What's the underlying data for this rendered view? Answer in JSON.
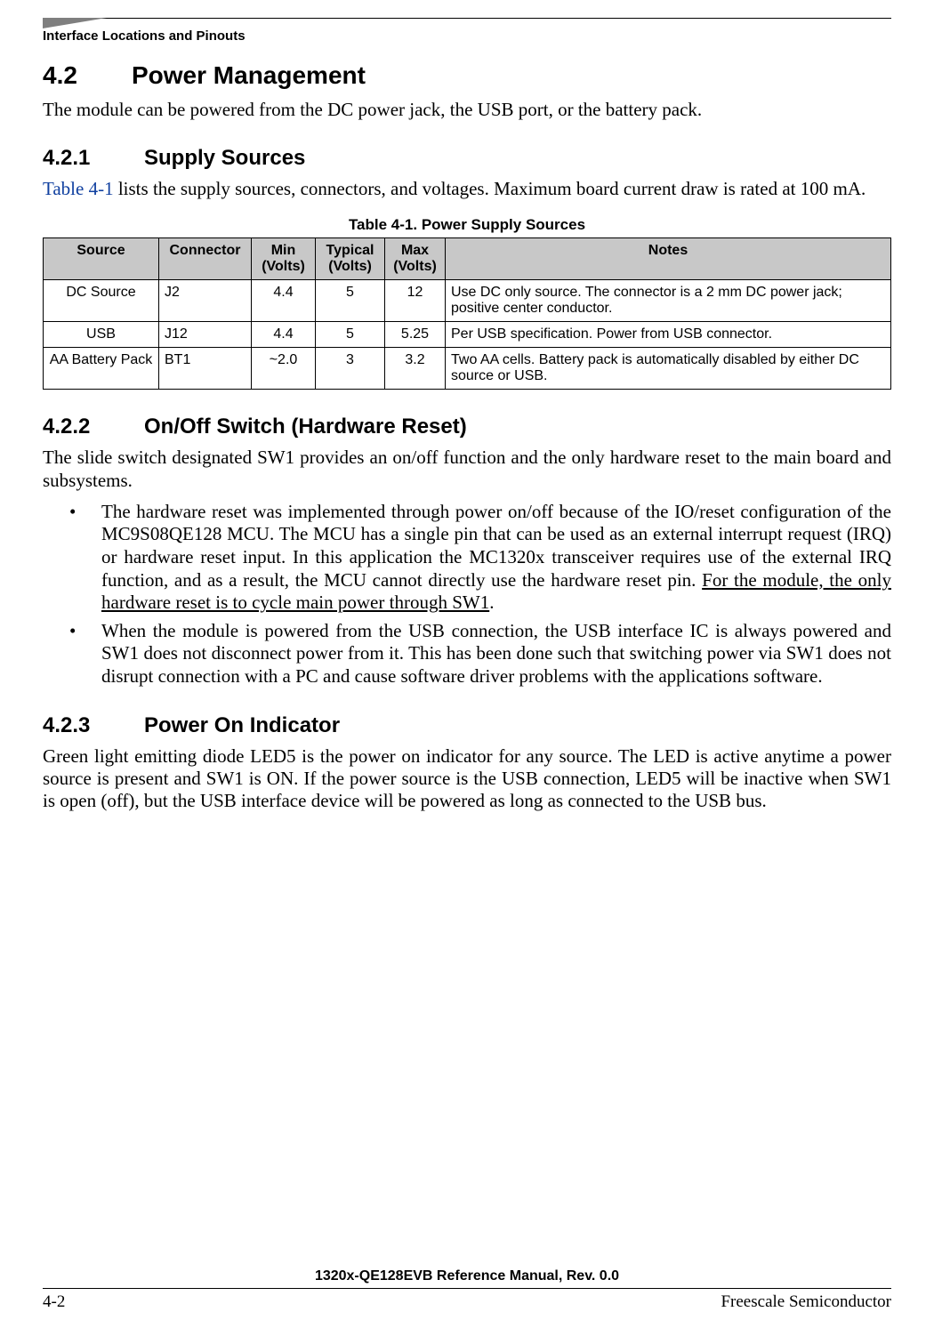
{
  "running_head": "Interface Locations and Pinouts",
  "sec42": {
    "num": "4.2",
    "title": "Power Management"
  },
  "p42": "The module can be powered from the DC power jack, the USB port, or the battery pack.",
  "sec421": {
    "num": "4.2.1",
    "title": "Supply Sources"
  },
  "p421_xref": "Table 4-1",
  "p421_rest": " lists the supply sources, connectors, and voltages. Maximum board current draw is rated at 100 mA.",
  "table": {
    "caption": "Table 4-1. Power Supply Sources",
    "headers": {
      "source": "Source",
      "connector": "Connector",
      "min": "Min (Volts)",
      "typ": "Typical (Volts)",
      "max": "Max (Volts)",
      "notes": "Notes"
    },
    "rows": [
      {
        "source": "DC Source",
        "connector": "J2",
        "min": "4.4",
        "typ": "5",
        "max": "12",
        "notes": "Use DC only source. The connector is a 2 mm DC power jack; positive center conductor."
      },
      {
        "source": "USB",
        "connector": "J12",
        "min": "4.4",
        "typ": "5",
        "max": "5.25",
        "notes": "Per USB specification. Power from USB connector."
      },
      {
        "source": "AA Battery Pack",
        "connector": "BT1",
        "min": "~2.0",
        "typ": "3",
        "max": "3.2",
        "notes": "Two AA cells. Battery pack is automatically disabled by either DC source or USB."
      }
    ]
  },
  "sec422": {
    "num": "4.2.2",
    "title": "On/Off Switch (Hardware Reset)"
  },
  "p422": "The slide switch designated SW1 provides an on/off function and the only hardware reset to the main board and subsystems.",
  "bullets422": {
    "b1_a": "The hardware reset was implemented through power on/off because of the IO/reset configuration of the MC9S08QE128 MCU. The MCU has a single pin that can be used as an external interrupt request (IRQ) or hardware reset input. In this application the MC1320x transceiver requires use of the external IRQ function, and as a result, the MCU cannot directly use the hardware reset pin. ",
    "b1_u": "For the module, the only hardware reset is to cycle main power through SW1",
    "b1_c": ".",
    "b2": "When the module is powered from the USB connection, the USB interface IC is always powered and SW1 does not disconnect power from it. This has been done such that switching power via SW1 does not disrupt connection with a PC and cause software driver problems with the applications software."
  },
  "sec423": {
    "num": "4.2.3",
    "title": "Power On Indicator"
  },
  "p423": "Green light emitting diode LED5 is the power on indicator for any source. The LED is active anytime a power source is present and SW1 is ON. If the power source is the USB connection, LED5 will be inactive when SW1 is open (off), but the USB interface device will be powered as long as connected to the USB bus.",
  "footer": {
    "title": "1320x-QE128EVB Reference Manual, Rev. 0.0",
    "page": "4-2",
    "company": "Freescale Semiconductor"
  }
}
